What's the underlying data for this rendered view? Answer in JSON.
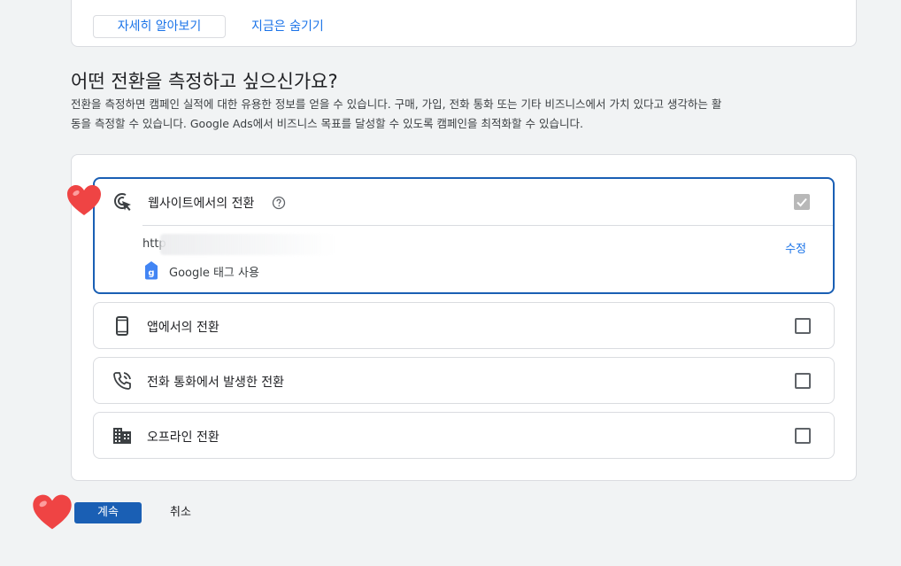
{
  "top_card": {
    "learn_more": "자세히 알아보기",
    "hide_now": "지금은 숨기기"
  },
  "section": {
    "title": "어떤 전환을 측정하고 싶으신가요?",
    "desc_line1": "전환을 측정하면 캠페인 실적에 대한 유용한 정보를 얻을 수 있습니다. 구매, 가입, 전화 통화 또는 기타 비즈니스에서 가치 있다고 생각하는 활",
    "desc_line2": "동을 측정할 수 있습니다. Google Ads에서 비즈니스 목표를 달성할 수 있도록 캠페인을 최적화할 수 있습니다."
  },
  "options": [
    {
      "label": "웹사이트에서의 전환",
      "icon": "cursor-click-icon",
      "checked": true
    },
    {
      "label": "앱에서의 전환",
      "icon": "smartphone-icon",
      "checked": false
    },
    {
      "label": "전화 통화에서 발생한 전환",
      "icon": "phone-call-icon",
      "checked": false
    },
    {
      "label": "오프라인 전환",
      "icon": "building-icon",
      "checked": false
    }
  ],
  "website_details": {
    "url_prefix": "http",
    "edit_label": "수정",
    "tag_label": "Google 태그 사용"
  },
  "actions": {
    "continue_label": "계속",
    "cancel_label": "취소"
  },
  "colors": {
    "accent": "#1a73e8",
    "primary_button": "#1a5fb4",
    "heart": "#ef4444"
  }
}
